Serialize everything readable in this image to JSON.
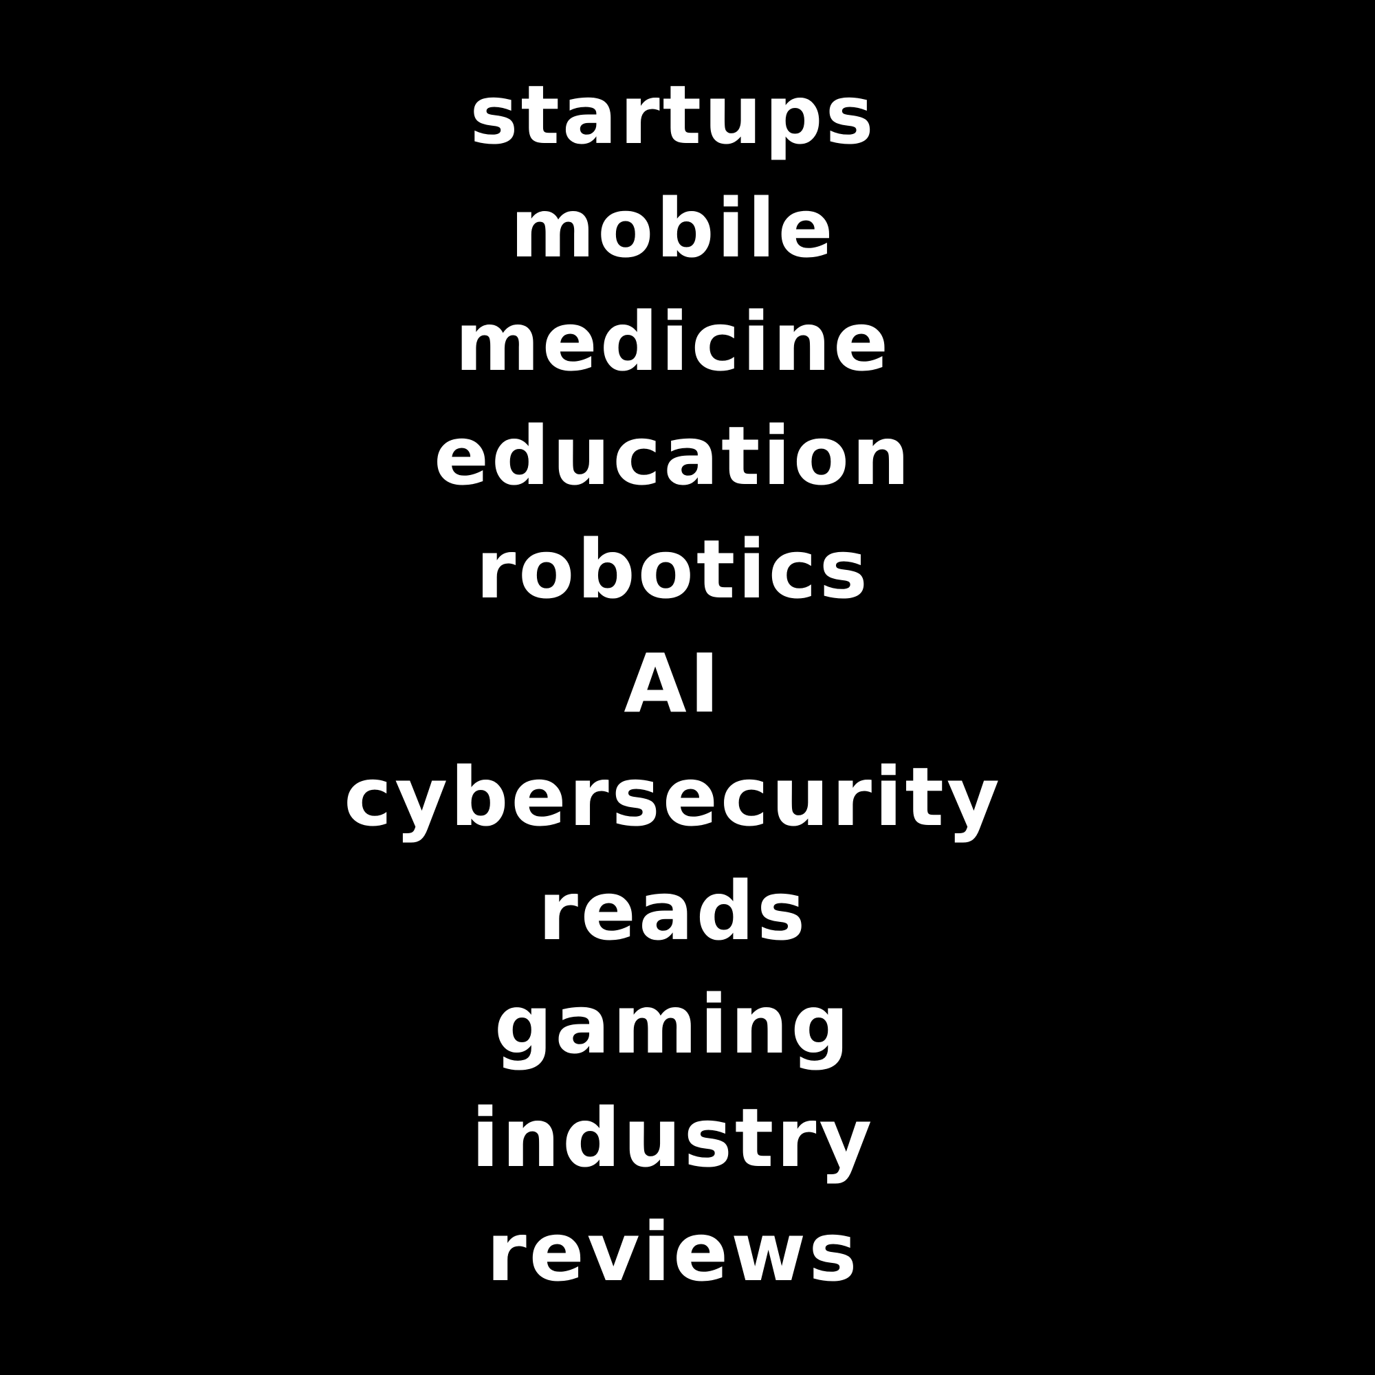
{
  "background_color": "#000000",
  "text_color": "#ffffff",
  "words": [
    "startups",
    "mobile",
    "medicine",
    "education",
    "robotics",
    "AI",
    "cybersecurity",
    "reads",
    "gaming",
    "industry",
    "reviews"
  ]
}
